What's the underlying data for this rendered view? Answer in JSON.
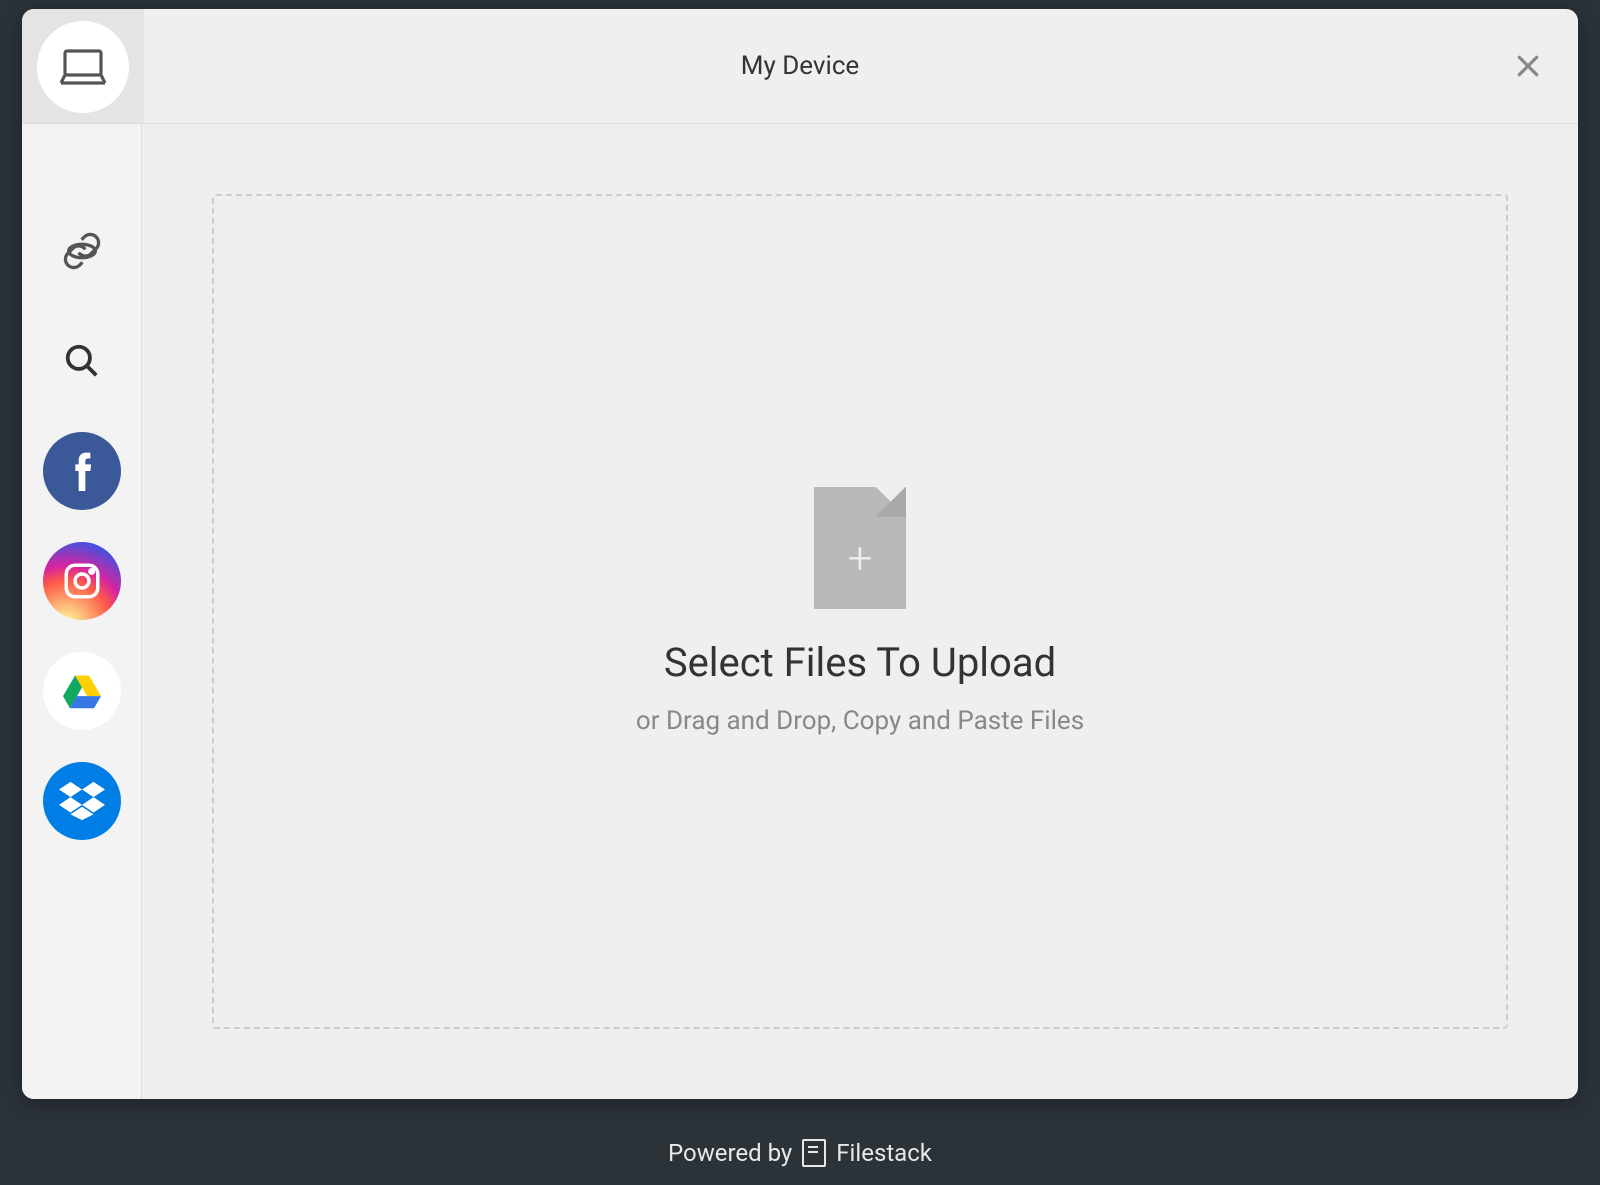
{
  "header": {
    "title": "My Device"
  },
  "sidebar": {
    "items": [
      {
        "id": "device",
        "label": "My Device"
      },
      {
        "id": "link",
        "label": "Link (URL)"
      },
      {
        "id": "search",
        "label": "Web Search"
      },
      {
        "id": "facebook",
        "label": "Facebook"
      },
      {
        "id": "instagram",
        "label": "Instagram"
      },
      {
        "id": "googledrive",
        "label": "Google Drive"
      },
      {
        "id": "dropbox",
        "label": "Dropbox"
      }
    ]
  },
  "dropzone": {
    "title": "Select Files To Upload",
    "subtitle": "or Drag and Drop, Copy and Paste Files"
  },
  "footer": {
    "prefix": "Powered by",
    "brand": "Filestack"
  }
}
